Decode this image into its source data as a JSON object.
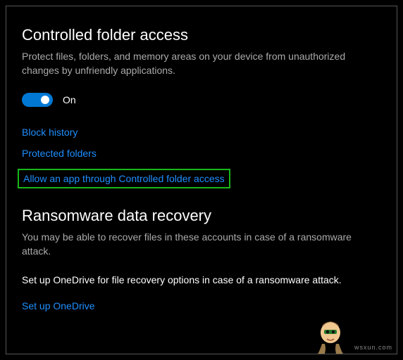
{
  "section1": {
    "title": "Controlled folder access",
    "desc": "Protect files, folders, and memory areas on your device from unauthorized changes by unfriendly applications.",
    "toggle": {
      "state": "on",
      "label": "On"
    },
    "links": {
      "block_history": "Block history",
      "protected_folders": "Protected folders",
      "allow_app": "Allow an app through Controlled folder access"
    }
  },
  "section2": {
    "title": "Ransomware data recovery",
    "desc": "You may be able to recover files in these accounts in case of a ransomware attack.",
    "body": "Set up OneDrive for file recovery options in case of a ransomware attack.",
    "link_setup": "Set up OneDrive"
  },
  "watermark": "wsxun.com"
}
